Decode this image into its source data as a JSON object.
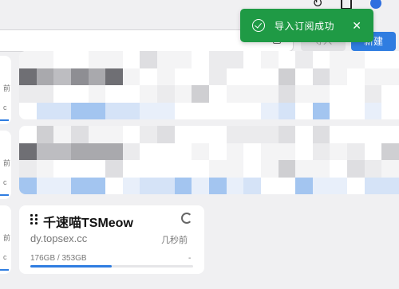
{
  "toolbar": {
    "import_label": "导入",
    "new_label": "新建"
  },
  "toast": {
    "message": "导入订阅成功",
    "close_glyph": "✕"
  },
  "profile": {
    "title": "千速喵TSMeow",
    "url": "dy.topsex.cc",
    "updated": "几秒前",
    "usage": "176GB / 353GB",
    "expire": "-",
    "usage_fraction": 0.4986
  },
  "left_slivers": [
    {
      "time_fragment": "前",
      "url_fragment": "c"
    },
    {
      "time_fragment": "前",
      "url_fragment": "c"
    },
    {
      "time_fragment": "前",
      "url_fragment": "c"
    }
  ],
  "colors": {
    "accent": "#2f7de1",
    "toast_bg": "#1f9a45",
    "card_bg": "#ffffff",
    "page_bg": "#f0f0f2"
  },
  "icons": {
    "refresh": "refresh-icon",
    "document": "document-icon",
    "avatar": "avatar-icon",
    "success": "check-circle-icon",
    "close": "close-icon",
    "drag": "drag-handle-icon"
  }
}
